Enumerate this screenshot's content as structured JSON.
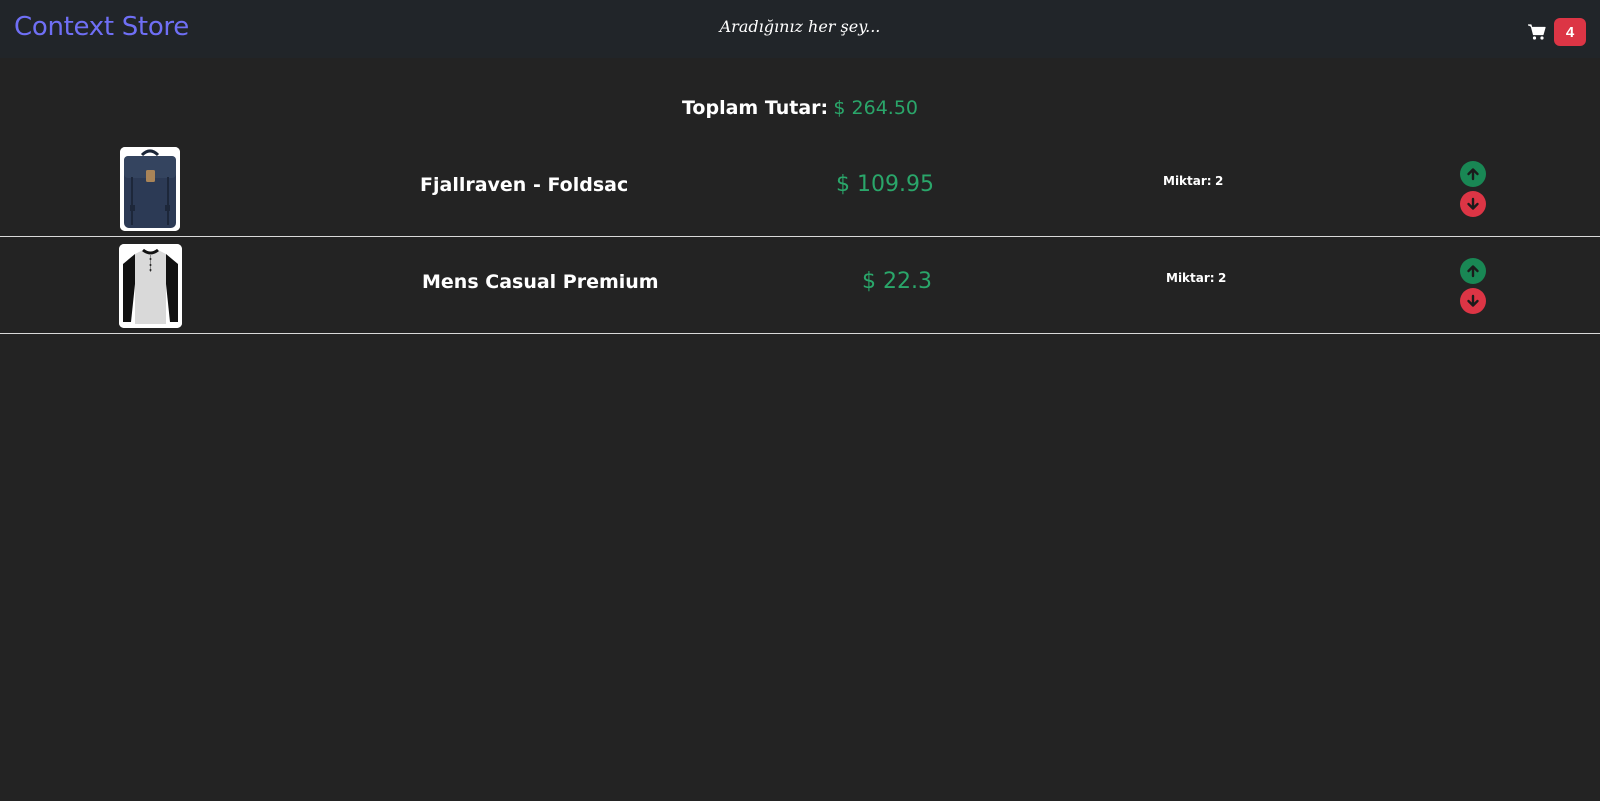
{
  "navbar": {
    "brand": "Context Store",
    "slogan": "Aradığınız her şey...",
    "cart_icon": "shopping-cart-icon",
    "cart_count": "4"
  },
  "summary": {
    "total_label": "Toplam Tutar:",
    "total_value": "$ 264.50"
  },
  "cart_items": [
    {
      "image": "backpack-product-image",
      "name": "Fjallraven - Foldsac",
      "price": "$ 109.95",
      "qty_label": "Miktar:",
      "qty_value": "2",
      "increase_icon": "arrow-up-circle-icon",
      "decrease_icon": "arrow-down-circle-icon"
    },
    {
      "image": "tshirt-product-image",
      "name": "Mens Casual Premium",
      "price": "$ 22.3",
      "qty_label": "Miktar:",
      "qty_value": "2",
      "increase_icon": "arrow-up-circle-icon",
      "decrease_icon": "arrow-down-circle-icon"
    }
  ],
  "colors": {
    "background": "#232323",
    "navbar": "#212529",
    "brand": "#6f6ff5",
    "price": "#2aa66a",
    "badge": "#dc3545",
    "increase": "#198754",
    "decrease": "#dc3545"
  }
}
